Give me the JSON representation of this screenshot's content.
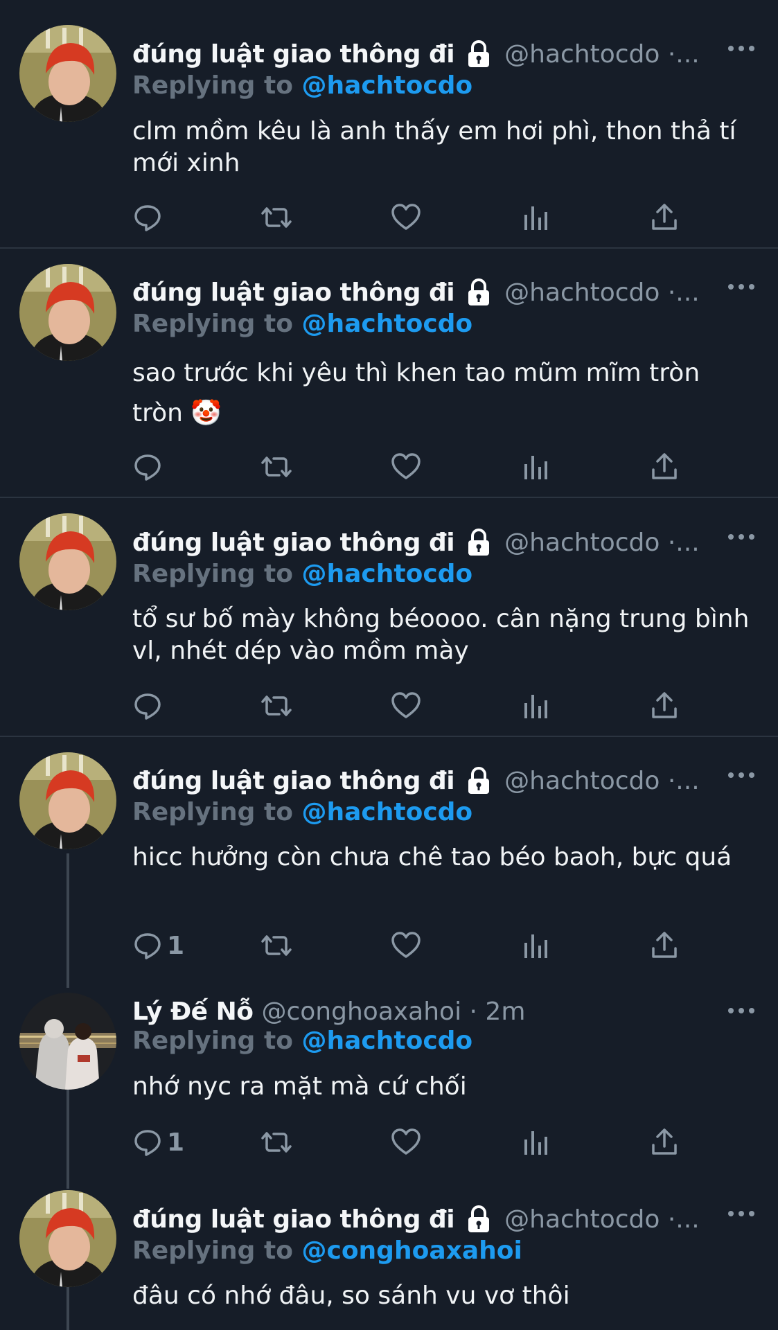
{
  "tweets": [
    {
      "name": "đúng luật giao thông đi",
      "handle": "@hachtocdo ·...",
      "reply_label": "Replying to",
      "reply_to": "@hachtocdo",
      "text": "clm mồm kêu là anh thấy em hơi phì, thon thả tí mới xinh",
      "reply_count": "",
      "locked": true
    },
    {
      "name": "đúng luật giao thông đi",
      "handle": "@hachtocdo ·...",
      "reply_label": "Replying to",
      "reply_to": "@hachtocdo",
      "text": "sao trước khi yêu thì khen tao mũm mĩm tròn tròn 🤡",
      "reply_count": "",
      "locked": true
    },
    {
      "name": "đúng luật giao thông đi",
      "handle": "@hachtocdo ·...",
      "reply_label": "Replying to",
      "reply_to": "@hachtocdo",
      "text": "tổ sư bố mày không béoooo. cân nặng trung bình vl, nhét dép vào mồm mày",
      "reply_count": "",
      "locked": true
    },
    {
      "name": "đúng luật giao thông đi",
      "handle": "@hachtocdo ·...",
      "reply_label": "Replying to",
      "reply_to": "@hachtocdo",
      "text": "hicc hưởng còn chưa chê tao béo baoh, bực quá",
      "reply_count": "1",
      "locked": true
    },
    {
      "name": "Lý Đế Nỗ",
      "handle": "@conghoaxahoi · 2m",
      "reply_label": "Replying to",
      "reply_to": "@hachtocdo",
      "text": "nhớ nyc ra mặt mà cứ chối",
      "reply_count": "1",
      "locked": false
    },
    {
      "name": "đúng luật giao thông đi",
      "handle": "@hachtocdo ·...",
      "reply_label": "Replying to",
      "reply_to": "@conghoaxahoi",
      "text": "đâu có nhớ đâu, so sánh vu vơ thôi",
      "reply_count": "",
      "locked": true
    }
  ],
  "icons": [
    "reply-icon",
    "retweet-icon",
    "like-icon",
    "analytics-icon",
    "share-icon",
    "more-icon",
    "lock-icon"
  ],
  "colors": {
    "background": "#161d28",
    "accent": "#1d9bf0",
    "muted": "#8b98a5",
    "divider": "#2b3440"
  }
}
